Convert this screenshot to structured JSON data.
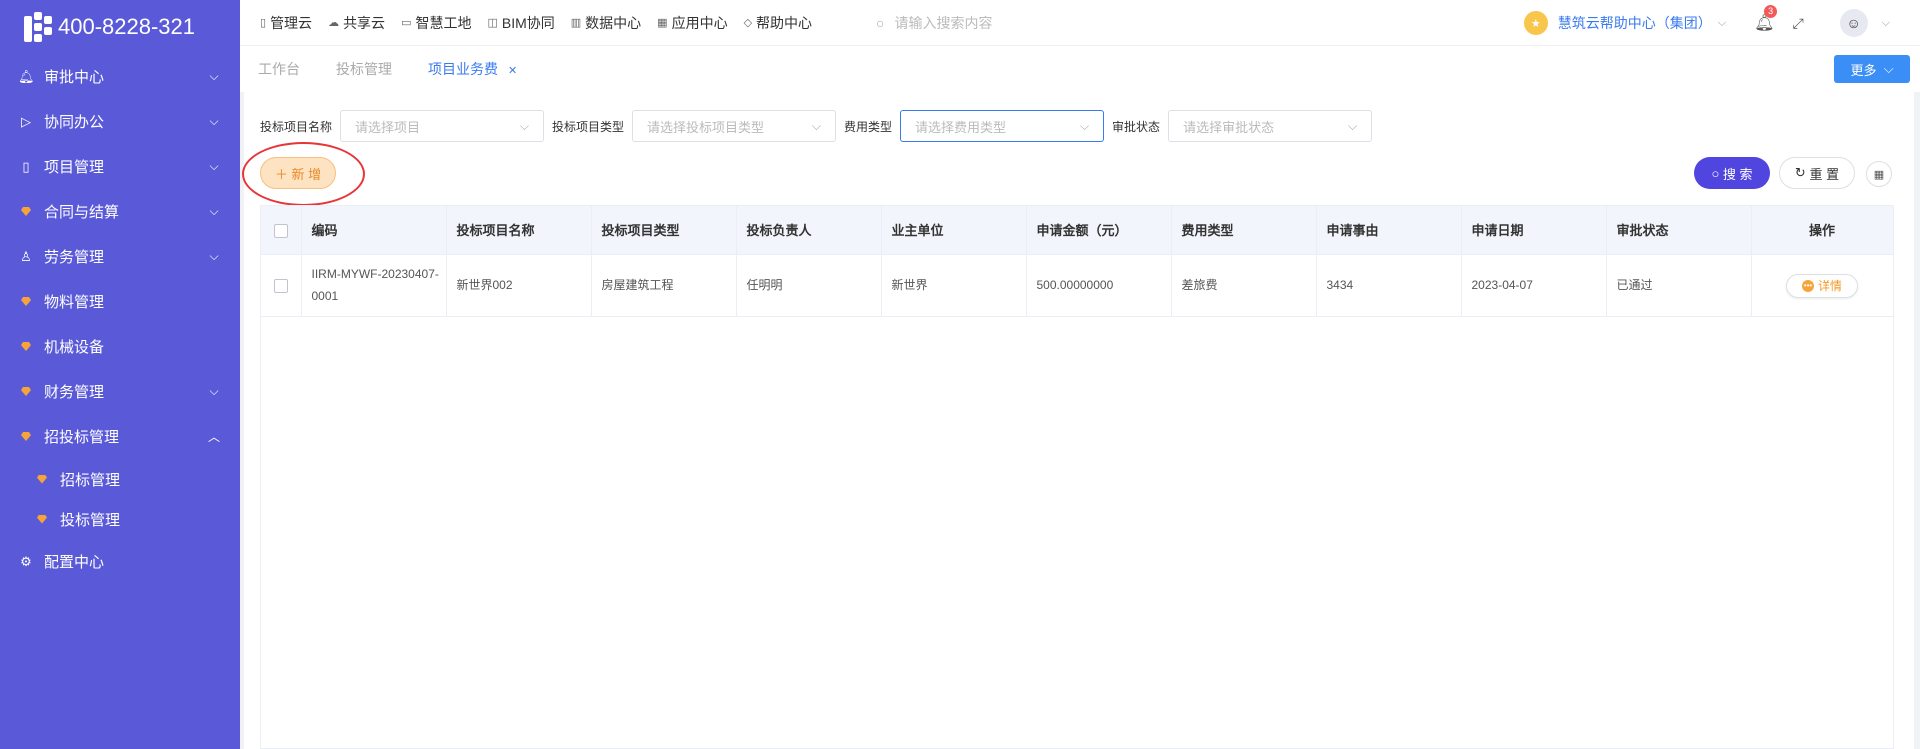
{
  "sidebar": {
    "brand_phone": "400-8228-321",
    "items": [
      {
        "label": "审批中心",
        "icon": "bell-icon",
        "expandable": true
      },
      {
        "label": "协同办公",
        "icon": "send-icon",
        "expandable": true
      },
      {
        "label": "项目管理",
        "icon": "book-icon",
        "expandable": true
      },
      {
        "label": "合同与结算",
        "icon": "gem-icon",
        "expandable": true
      },
      {
        "label": "劳务管理",
        "icon": "user-icon",
        "expandable": true
      },
      {
        "label": "物料管理",
        "icon": "gem-icon",
        "expandable": false
      },
      {
        "label": "机械设备",
        "icon": "gem-icon",
        "expandable": false
      },
      {
        "label": "财务管理",
        "icon": "gem-icon",
        "expandable": true
      },
      {
        "label": "招投标管理",
        "icon": "gem-icon",
        "expandable": true,
        "expanded": true
      },
      {
        "label": "招标管理",
        "icon": "gem-icon",
        "sub": true
      },
      {
        "label": "投标管理",
        "icon": "gem-icon",
        "sub": true
      },
      {
        "label": "配置中心",
        "icon": "gear-icon",
        "expandable": false
      }
    ]
  },
  "topnav": {
    "links": [
      {
        "label": "管理云",
        "icon": "document-icon"
      },
      {
        "label": "共享云",
        "icon": "cloud-icon"
      },
      {
        "label": "智慧工地",
        "icon": "book-icon"
      },
      {
        "label": "BIM协同",
        "icon": "cube-icon"
      },
      {
        "label": "数据中心",
        "icon": "bar-chart-icon"
      },
      {
        "label": "应用中心",
        "icon": "grid-icon"
      },
      {
        "label": "帮助中心",
        "icon": "diamond-icon"
      }
    ],
    "search_placeholder": "请输入搜索内容",
    "org_name": "慧筑云帮助中心（集团）",
    "notification_count": "3"
  },
  "tabs": {
    "items": [
      {
        "label": "工作台",
        "active": false
      },
      {
        "label": "投标管理",
        "active": false
      },
      {
        "label": "项目业务费",
        "active": true,
        "closable": true
      }
    ],
    "more_label": "更多"
  },
  "filters": [
    {
      "label": "投标项目名称",
      "placeholder": "请选择项目"
    },
    {
      "label": "投标项目类型",
      "placeholder": "请选择投标项目类型"
    },
    {
      "label": "费用类型",
      "placeholder": "请选择费用类型"
    },
    {
      "label": "审批状态",
      "placeholder": "请选择审批状态"
    }
  ],
  "actions": {
    "add_label": "＋ 新 增",
    "search_label": "搜 索",
    "reset_label": "重 置"
  },
  "table": {
    "columns": [
      "编码",
      "投标项目名称",
      "投标项目类型",
      "投标负责人",
      "业主单位",
      "申请金额（元）",
      "费用类型",
      "申请事由",
      "申请日期",
      "审批状态",
      "操作"
    ],
    "rows": [
      {
        "code": "IIRM-MYWF-20230407-0001",
        "project_name": "新世界002",
        "project_type": "房屋建筑工程",
        "owner": "任明明",
        "client": "新世界",
        "amount": "500.00000000",
        "fee_type": "差旅费",
        "reason": "3434",
        "date": "2023-04-07",
        "status": "已通过",
        "action_label": "详情"
      }
    ]
  },
  "colors": {
    "sidebar_bg": "#5a5ad8",
    "accent_blue": "#3a7bf0",
    "search_btn": "#5145e0",
    "add_btn_bg": "#fde3c2",
    "highlight_ring": "#e8353a"
  }
}
